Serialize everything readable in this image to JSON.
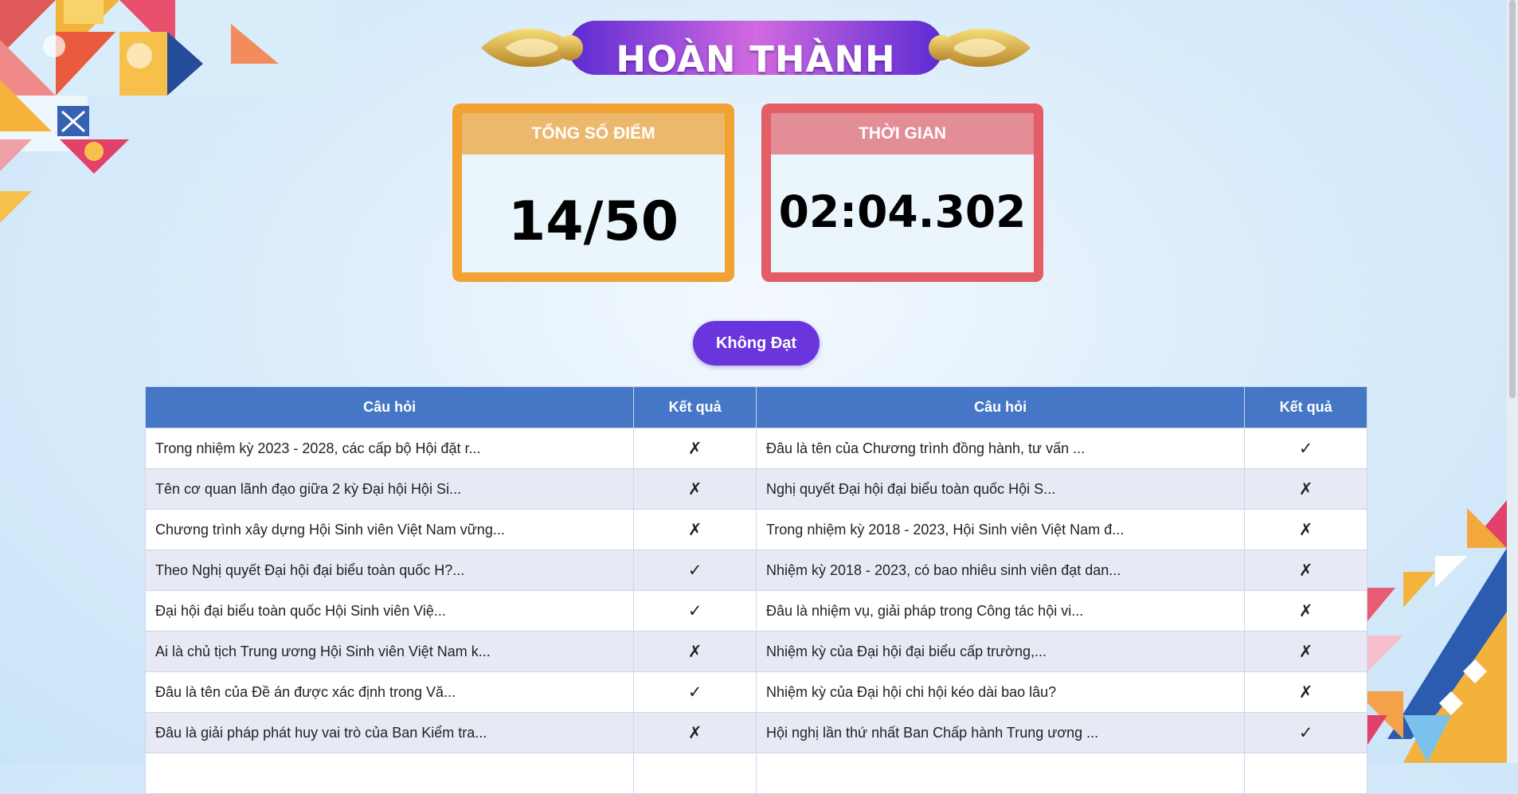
{
  "banner": {
    "title": "HOÀN THÀNH"
  },
  "score_card": {
    "label": "TỔNG SỐ ĐIỂM",
    "value": "14/50"
  },
  "time_card": {
    "label": "THỜI GIAN",
    "value": "02:04.302"
  },
  "status_button": {
    "label": "Không Đạt"
  },
  "table": {
    "headers": [
      "Câu hỏi",
      "Kết quả",
      "Câu hỏi",
      "Kết quả"
    ],
    "rows": [
      {
        "q1": "Trong nhiệm kỳ 2023 - 2028, các cấp bộ Hội đặt r...",
        "r1": "✗",
        "q2": "Đâu là tên của Chương trình đồng hành, tư vấn ...",
        "r2": "✓"
      },
      {
        "q1": "Tên cơ quan lãnh đạo giữa 2 kỳ Đại hội Hội Si...",
        "r1": "✗",
        "q2": "Nghị quyết Đại hội đại biểu toàn quốc Hội S...",
        "r2": "✗"
      },
      {
        "q1": "Chương trình xây dựng Hội Sinh viên Việt Nam vững...",
        "r1": "✗",
        "q2": "Trong nhiệm kỳ 2018 - 2023, Hội Sinh viên Việt Nam đ...",
        "r2": "✗"
      },
      {
        "q1": "Theo Nghị quyết Đại hội đại biểu toàn quốc H?...",
        "r1": "✓",
        "q2": "Nhiệm kỳ 2018 - 2023, có bao nhiêu sinh viên đạt dan...",
        "r2": "✗"
      },
      {
        "q1": "Đại hội đại biểu toàn quốc Hội Sinh viên Việ...",
        "r1": "✓",
        "q2": "Đâu là nhiệm vụ, giải pháp trong Công tác hội vi...",
        "r2": "✗"
      },
      {
        "q1": "Ai là chủ tịch Trung ương Hội Sinh viên Việt Nam k...",
        "r1": "✗",
        "q2": "Nhiệm kỳ của Đại hội đại biểu cấp trường,...",
        "r2": "✗"
      },
      {
        "q1": "Đâu là tên của Đề án được xác định trong Vă...",
        "r1": "✓",
        "q2": "Nhiệm kỳ của Đại hội chi hội kéo dài bao lâu?",
        "r2": "✗"
      },
      {
        "q1": "Đâu là giải pháp phát huy vai trò của Ban Kiểm tra...",
        "r1": "✗",
        "q2": "Hội nghị lần thứ nhất Ban Chấp hành Trung ương ...",
        "r2": "✓"
      },
      {
        "q1": "",
        "r1": "",
        "q2": "",
        "r2": ""
      }
    ]
  },
  "colors": {
    "score_border": "#f2a232",
    "time_border": "#e45d66",
    "button": "#6a35dc",
    "table_header": "#4677c6"
  }
}
